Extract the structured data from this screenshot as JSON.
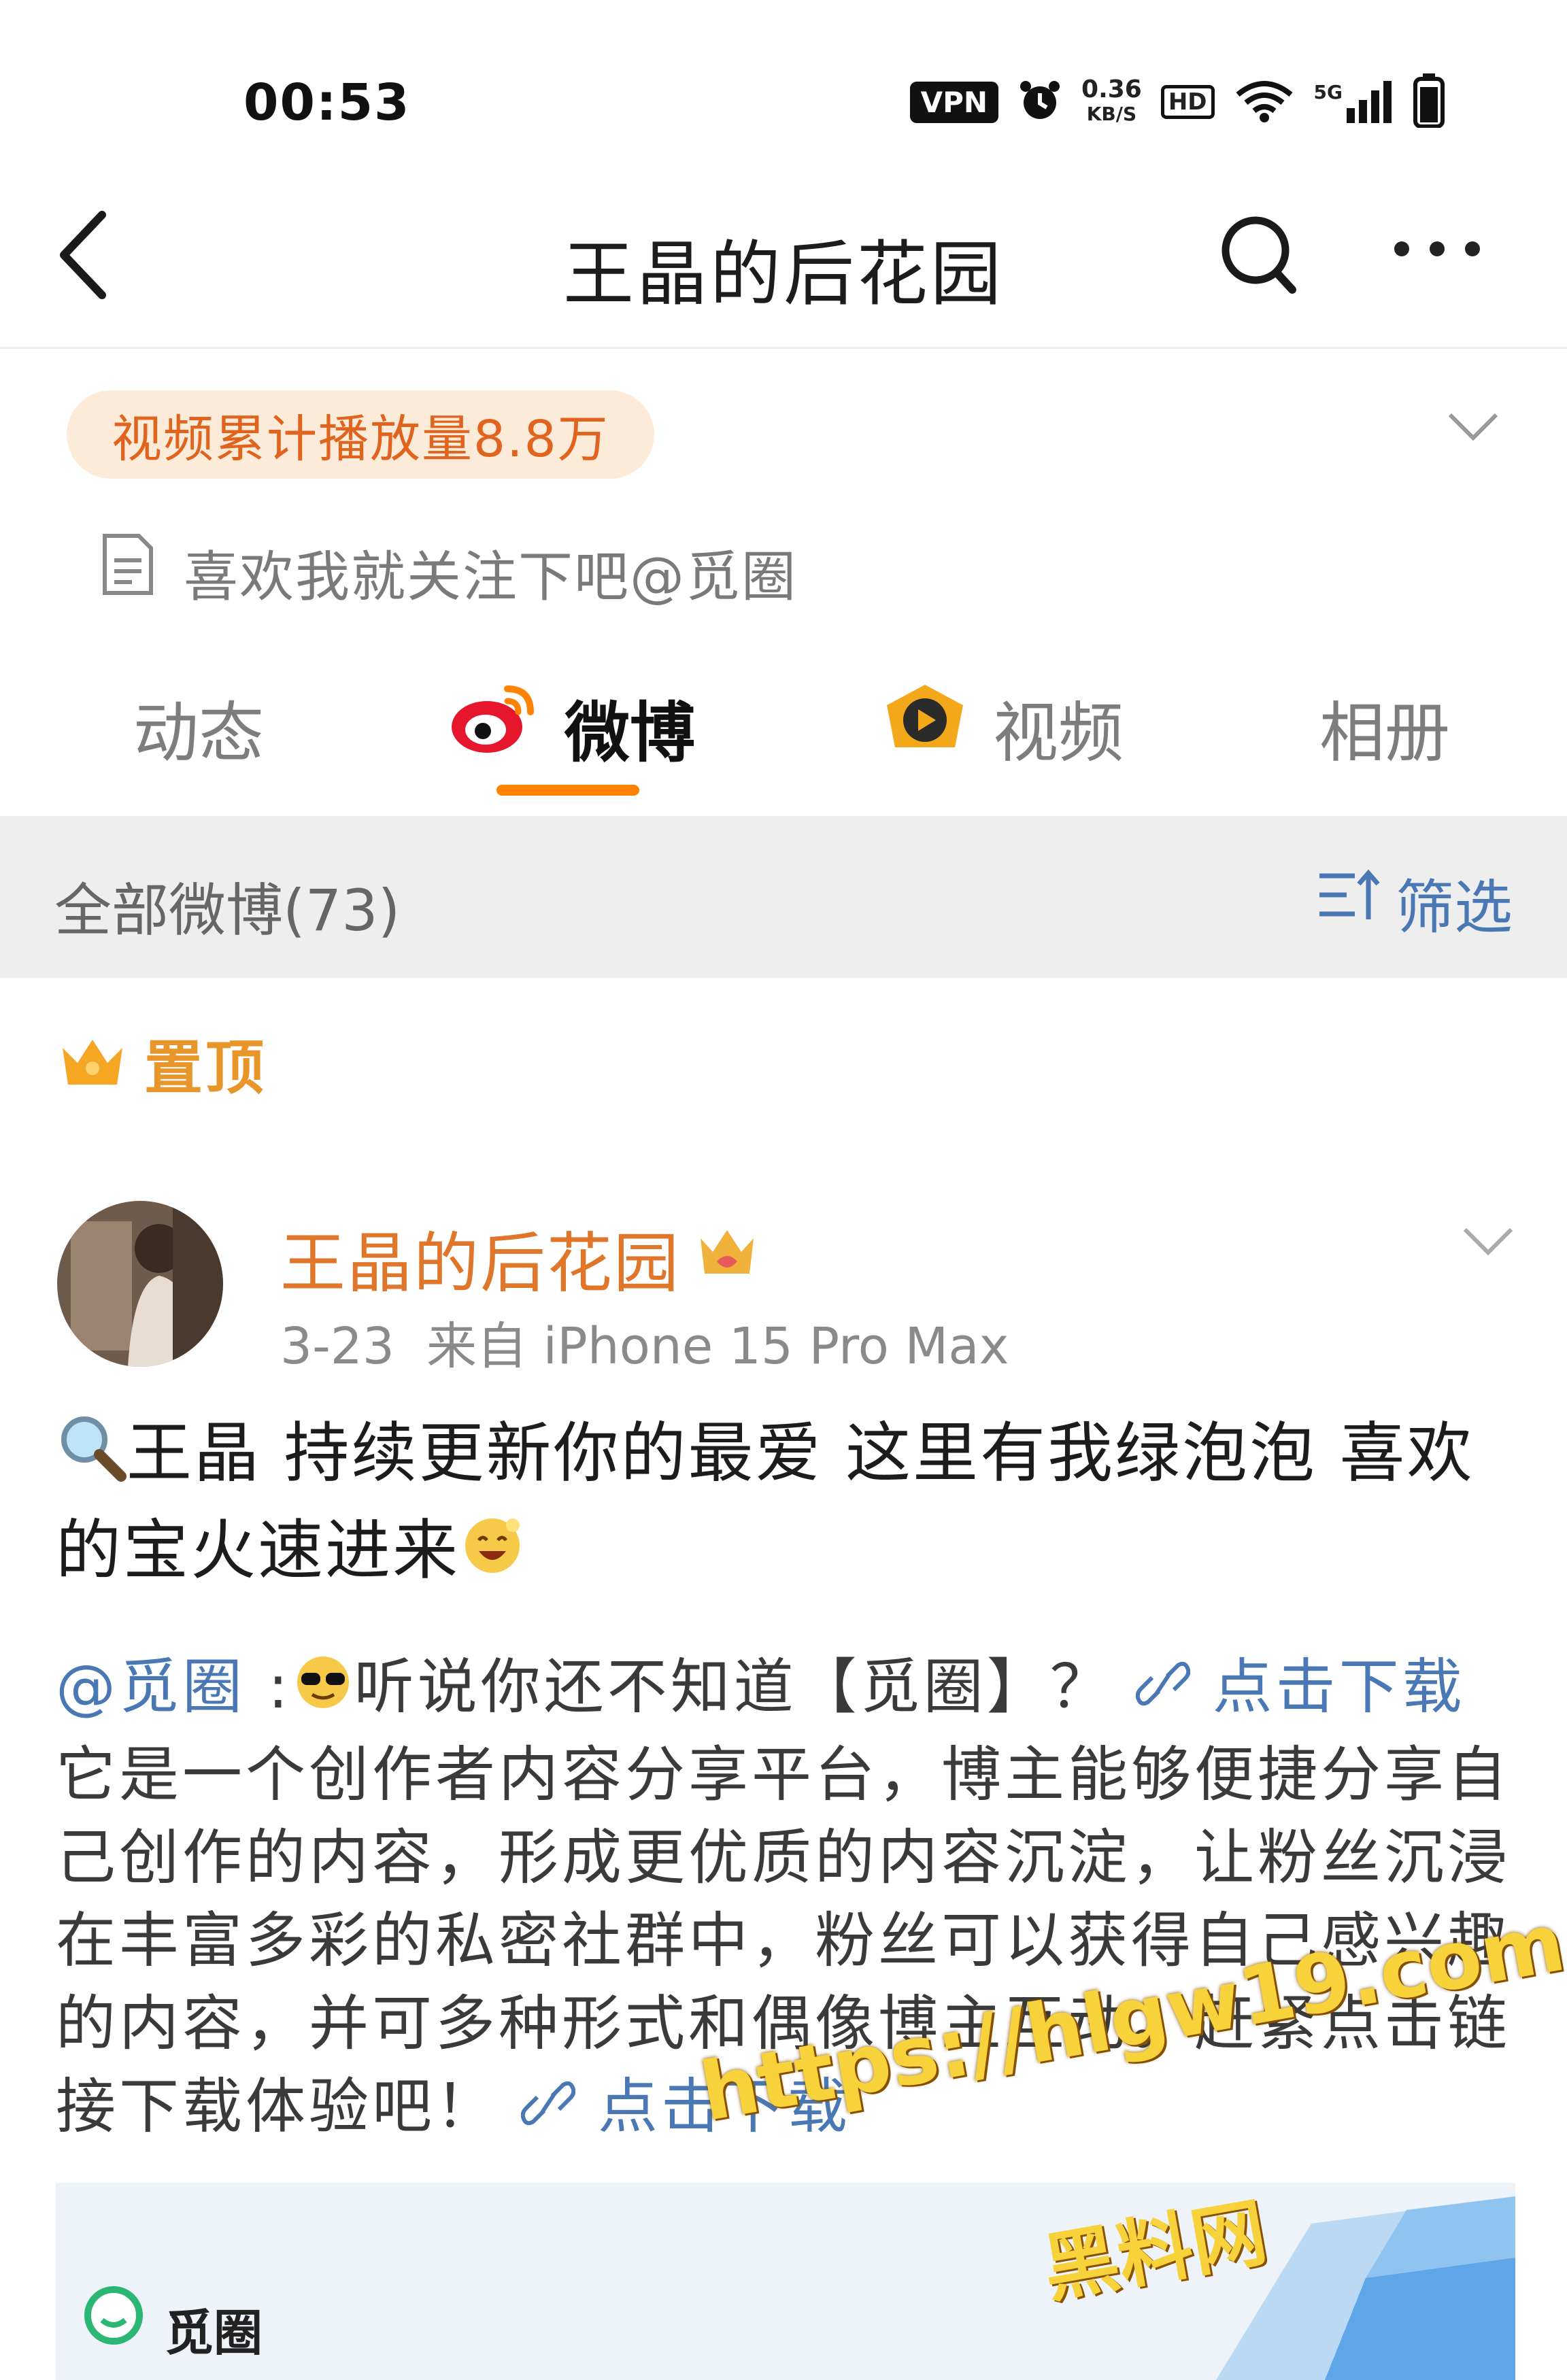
{
  "status_bar": {
    "time": "00:53",
    "vpn": "VPN",
    "speed_value": "0.36",
    "speed_unit": "KB/S",
    "hd": "HD",
    "network": "5G"
  },
  "nav": {
    "title": "王晶的后花园"
  },
  "profile": {
    "play_count_pill": "视频累计播放量8.8万",
    "bio": "喜欢我就关注下吧@觅圈"
  },
  "tabs": [
    {
      "label": "动态",
      "active": false
    },
    {
      "label": "微博",
      "active": true
    },
    {
      "label": "视频",
      "active": false
    },
    {
      "label": "相册",
      "active": false
    }
  ],
  "filter_bar": {
    "count_label": "全部微博(73)",
    "filter_label": "筛选"
  },
  "pinned_label": "置顶",
  "post": {
    "author": "王晶的后花园",
    "date": "3-23",
    "source": "来自 iPhone 15 Pro Max",
    "text": "王晶 持续更新你的最爱 这里有我绿泡泡 喜欢的宝火速进来",
    "mention": "@觅圈",
    "mention_tail": "听说你还不知道【觅圈】？",
    "link_label": "点击下载",
    "body": "它是一个创作者内容分享平台，博主能够便捷分享自己创作的内容，形成更优质的内容沉淀，让粉丝沉浸在丰富多彩的私密社群中，粉丝可以获得自己感兴趣的内容，并可多种形式和偶像博主互动。赶紧点击链接下载体验吧！",
    "link_label_2": "点击下载",
    "card_name": "觅圈"
  },
  "watermark": {
    "url": "https://hlgw19.com",
    "name": "黑料网"
  },
  "colors": {
    "accent_orange": "#ff8200",
    "link_blue": "#4a78b4",
    "author_orange": "#e0762a",
    "pill_bg": "#fdebd9"
  }
}
